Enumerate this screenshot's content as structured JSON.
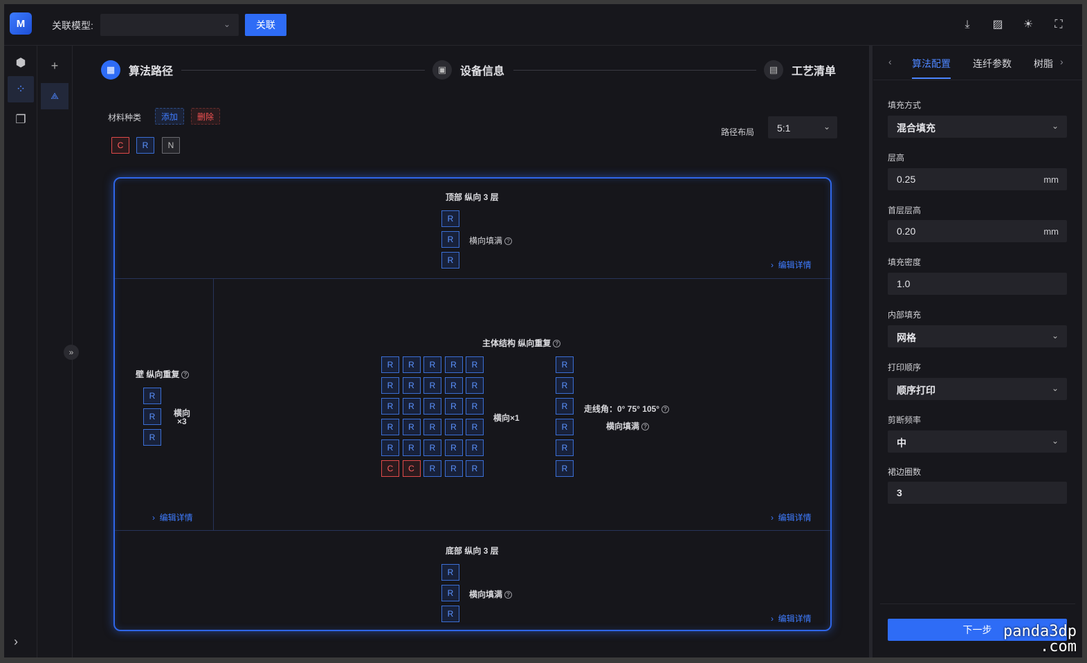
{
  "header": {
    "logo_text": "M",
    "assoc_label": "关联模型:",
    "assoc_value": "",
    "assoc_button": "关联",
    "icons": [
      "download-icon",
      "image-icon",
      "sun-icon",
      "fullscreen-icon"
    ]
  },
  "steps": [
    {
      "num": "▦",
      "label": "算法路径",
      "active": true
    },
    {
      "num": "▣",
      "label": "设备信息",
      "active": false
    },
    {
      "num": "▤",
      "label": "工艺清单",
      "active": false
    }
  ],
  "materials": {
    "label": "材料种类",
    "add_label": "添加",
    "delete_label": "删除",
    "chips": [
      "C",
      "R",
      "N"
    ]
  },
  "layout": {
    "label": "路径布局",
    "value": "5:1"
  },
  "top_section": {
    "title": "顶部 纵向 3 层",
    "boxes": [
      "R",
      "R",
      "R"
    ],
    "fill_text": "横向填满",
    "edit": "编辑详情"
  },
  "wall_section": {
    "title": "壁 纵向重复",
    "boxes": [
      "R",
      "R",
      "R"
    ],
    "horizontal": "横向",
    "times": "×3",
    "edit": "编辑详情"
  },
  "main_section": {
    "title": "主体结构 纵向重复",
    "grid": [
      [
        "R",
        "R",
        "R",
        "R",
        "R"
      ],
      [
        "R",
        "R",
        "R",
        "R",
        "R"
      ],
      [
        "R",
        "R",
        "R",
        "R",
        "R"
      ],
      [
        "R",
        "R",
        "R",
        "R",
        "R"
      ],
      [
        "R",
        "R",
        "R",
        "R",
        "R"
      ],
      [
        "C",
        "C",
        "R",
        "R",
        "R"
      ]
    ],
    "horizontal_x1": "横向×1",
    "column": [
      "R",
      "R",
      "R",
      "R",
      "R",
      "R"
    ],
    "angle_text": "走线角：0° 75° 105°",
    "fill_text": "横向填满",
    "edit": "编辑详情"
  },
  "bottom_section": {
    "title": "底部 纵向 3 层",
    "boxes": [
      "R",
      "R",
      "R"
    ],
    "fill_text": "横向填满",
    "edit": "编辑详情"
  },
  "right_panel": {
    "tabs": [
      "算法配置",
      "连纤参数",
      "树脂"
    ],
    "fields": [
      {
        "label": "填充方式",
        "value": "混合填充",
        "type": "select"
      },
      {
        "label": "层高",
        "value": "0.25",
        "unit": "mm",
        "type": "input"
      },
      {
        "label": "首层层高",
        "value": "0.20",
        "unit": "mm",
        "type": "input"
      },
      {
        "label": "填充密度",
        "value": "1.0",
        "type": "input"
      },
      {
        "label": "内部填充",
        "value": "网格",
        "type": "select"
      },
      {
        "label": "打印顺序",
        "value": "顺序打印",
        "type": "select"
      },
      {
        "label": "剪断频率",
        "value": "中",
        "type": "select"
      },
      {
        "label": "裙边圈数",
        "value": "3",
        "type": "input"
      }
    ],
    "next_button": "下一步"
  },
  "watermark": {
    "line1": "panda3dp",
    "line2": ".com"
  }
}
